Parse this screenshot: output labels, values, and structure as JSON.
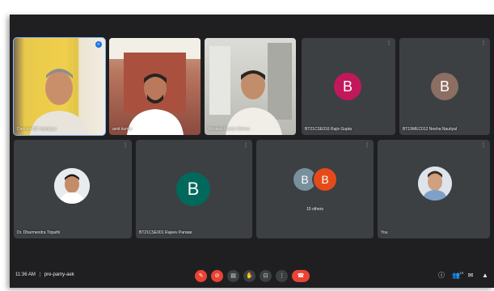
{
  "meeting": {
    "time": "11:36 AM",
    "separator": "|",
    "code": "pre-pamy-aek"
  },
  "participants": [
    {
      "name": "Director NIT Hamirpur",
      "tile": "video",
      "active": true
    },
    {
      "name": "amit kumar",
      "tile": "video"
    },
    {
      "name": "Mehlesh Kumar Meena",
      "tile": "video"
    },
    {
      "name": "BT21CSE016 Rajiv Gupta",
      "tile": "avatar",
      "initial": "B",
      "color": "#c2185b"
    },
    {
      "name": "BT19MEC012 Neeha Nautiyal",
      "tile": "avatar",
      "initial": "B",
      "color": "#8d6e63"
    },
    {
      "name": "Dr. Dharmendra Tripathi",
      "tile": "photo"
    },
    {
      "name": "BT21CSE001 Rajeev Panwar",
      "tile": "avatar",
      "initial": "B",
      "color": "#00695c"
    },
    {
      "name": "15 others",
      "tile": "others",
      "initials": [
        "B",
        "B"
      ],
      "colors": [
        "#78909c",
        "#e64a19"
      ]
    },
    {
      "name": "You",
      "tile": "photo"
    }
  ],
  "tile_more_glyph": "⋮",
  "people_count": "19",
  "controls": {
    "mic": "mic-off-icon",
    "camera": "camera-off-icon",
    "captions": "captions-icon",
    "raise_hand": "raise-hand-icon",
    "present": "present-icon",
    "more": "more-options-icon",
    "leave": "leave-call-icon"
  },
  "colors": {
    "background": "#1f1f21",
    "tile": "#3c4043",
    "accent": "#8ab4f8",
    "danger": "#ea4335"
  }
}
